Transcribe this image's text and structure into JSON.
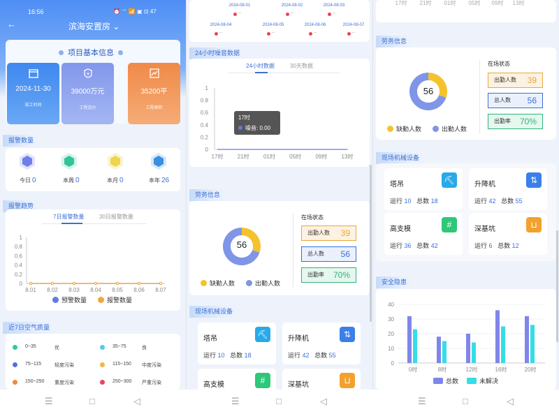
{
  "status_bar": {
    "time": "16:56",
    "icons": "⏰ ⌔ 📶 ▣ ⊡ 47"
  },
  "header": {
    "title": "滨海安置房 ⌄",
    "back": "←"
  },
  "project": {
    "section_title": "项目基本信息",
    "stats": [
      {
        "value": "2024-11-30",
        "label": "竣工时间",
        "icon": "calendar-icon",
        "color": "#4a8ef0"
      },
      {
        "value": "39000万元",
        "label": "工程造价",
        "icon": "money-icon",
        "color": "#8aa3ee"
      },
      {
        "value": "35200平",
        "label": "工程面积",
        "icon": "area-chart-icon",
        "color": "#f39a5c"
      }
    ]
  },
  "alarm_count": {
    "title": "报警数量",
    "items": [
      {
        "label": "今日",
        "value": "0",
        "color": "#6f7ee8"
      },
      {
        "label": "本周",
        "value": "0",
        "color": "#34c29a"
      },
      {
        "label": "本月",
        "value": "0",
        "color": "#f0d44c"
      },
      {
        "label": "本年",
        "value": "26",
        "color": "#3b8fe0"
      }
    ]
  },
  "alarm_trend": {
    "title": "报警趋势",
    "tabs": [
      "7日报警数量",
      "30日报警数量"
    ],
    "y_ticks": [
      "1",
      "0.8",
      "0.6",
      "0.4",
      "0.2",
      "0"
    ],
    "legend": [
      "预警数量",
      "报警数量"
    ]
  },
  "air_quality": {
    "title": "近7日空气质量",
    "rows": [
      {
        "range": "0~35",
        "level": "优",
        "color": "#2dc7a0"
      },
      {
        "range": "35~75",
        "level": "良",
        "color": "#4ccfe8"
      },
      {
        "range": "75~115",
        "level": "轻度污染",
        "color": "#5170d8"
      },
      {
        "range": "115~150",
        "level": "中度污染",
        "color": "#f2b640"
      },
      {
        "range": "150~250",
        "level": "重度污染",
        "color": "#ec8a3a"
      },
      {
        "range": "250~300",
        "level": "严重污染",
        "color": "#e8455a"
      }
    ]
  },
  "noise": {
    "dates": [
      {
        "date": "2024-08-01",
        "val": "--"
      },
      {
        "date": "2024-08-02",
        "val": "--"
      },
      {
        "date": "2024-08-03",
        "val": "--"
      },
      {
        "date": "2024-08-04",
        "val": "--"
      },
      {
        "date": "2024-08-05",
        "val": "--"
      },
      {
        "date": "2024-08-06",
        "val": "--"
      },
      {
        "date": "2024-08-07",
        "val": "--"
      }
    ],
    "title": "24小时噪音数据",
    "tabs": [
      "24小时数据",
      "30天数据"
    ],
    "y_ticks": [
      "1",
      "0.8",
      "0.6",
      "0.4",
      "0.2",
      "0"
    ],
    "tooltip": {
      "time": "17时",
      "label": "噪音: 0.00"
    }
  },
  "labor": {
    "title": "劳务信息",
    "donut_value": "56",
    "legend": [
      "缺勤人数",
      "出勤人数"
    ],
    "status_title": "在场状态",
    "status": [
      {
        "label": "出勤人数",
        "value": "39",
        "color": "#e8a93a",
        "bg": "#fdf1e2"
      },
      {
        "label": "总人数",
        "value": "56",
        "color": "#3a6fd8",
        "bg": "#eaf1fd"
      },
      {
        "label": "出勤率",
        "value": "70%",
        "color": "#2fb37a",
        "bg": "#e6f7ef"
      }
    ]
  },
  "machines": {
    "title": "现场机械设备",
    "items": [
      {
        "name": "塔吊",
        "run_label": "运行",
        "run": "10",
        "total_label": "总数",
        "total": "18",
        "icon": "tower-crane-icon",
        "color": "#29a9e8",
        "glyph": "⛏"
      },
      {
        "name": "升降机",
        "run_label": "运行",
        "run": "42",
        "total_label": "总数",
        "total": "55",
        "icon": "elevator-icon",
        "color": "#3b7fe8",
        "glyph": "⇅"
      },
      {
        "name": "高支模",
        "run_label": "运行",
        "run": "36",
        "total_label": "总数",
        "total": "42",
        "icon": "formwork-icon",
        "color": "#2fc77a",
        "glyph": "#"
      },
      {
        "name": "深基坑",
        "run_label": "运行",
        "run": "6",
        "total_label": "总数",
        "total": "12",
        "icon": "pit-icon",
        "color": "#f3a12e",
        "glyph": "⊔"
      }
    ]
  },
  "safety": {
    "title": "安全隐患",
    "legend": [
      "总数",
      "未解决"
    ]
  },
  "chart_data": [
    {
      "type": "line",
      "title": "报警趋势",
      "categories": [
        "8.01",
        "8.02",
        "8.03",
        "8.04",
        "8.05",
        "8.06",
        "8.07"
      ],
      "series": [
        {
          "name": "预警数量",
          "values": [
            0,
            0,
            0,
            0,
            0,
            0,
            0
          ]
        },
        {
          "name": "报警数量",
          "values": [
            0,
            0,
            0,
            0,
            0,
            0,
            0
          ]
        }
      ],
      "ylim": [
        0,
        1
      ]
    },
    {
      "type": "line",
      "title": "24小时噪音数据",
      "categories": [
        "17时",
        "21时",
        "01时",
        "05时",
        "09时",
        "13时"
      ],
      "series": [
        {
          "name": "噪音",
          "values": [
            0,
            0,
            0,
            0,
            0,
            0
          ]
        }
      ],
      "ylim": [
        0,
        1
      ]
    },
    {
      "type": "pie",
      "title": "劳务信息",
      "categories": [
        "缺勤人数",
        "出勤人数"
      ],
      "values": [
        17,
        39
      ]
    },
    {
      "type": "bar",
      "title": "安全隐患",
      "categories": [
        "0时",
        "8时",
        "12时",
        "16时",
        "20时"
      ],
      "series": [
        {
          "name": "总数",
          "values": [
            32,
            18,
            20,
            36,
            32
          ]
        },
        {
          "name": "未解决",
          "values": [
            23,
            15,
            14,
            25,
            26
          ]
        }
      ],
      "ylim": [
        0,
        40
      ],
      "y_ticks": [
        "0",
        "10",
        "20",
        "30",
        "40"
      ]
    }
  ],
  "navbar": {
    "menu": "☰",
    "home": "□",
    "back": "◁"
  }
}
